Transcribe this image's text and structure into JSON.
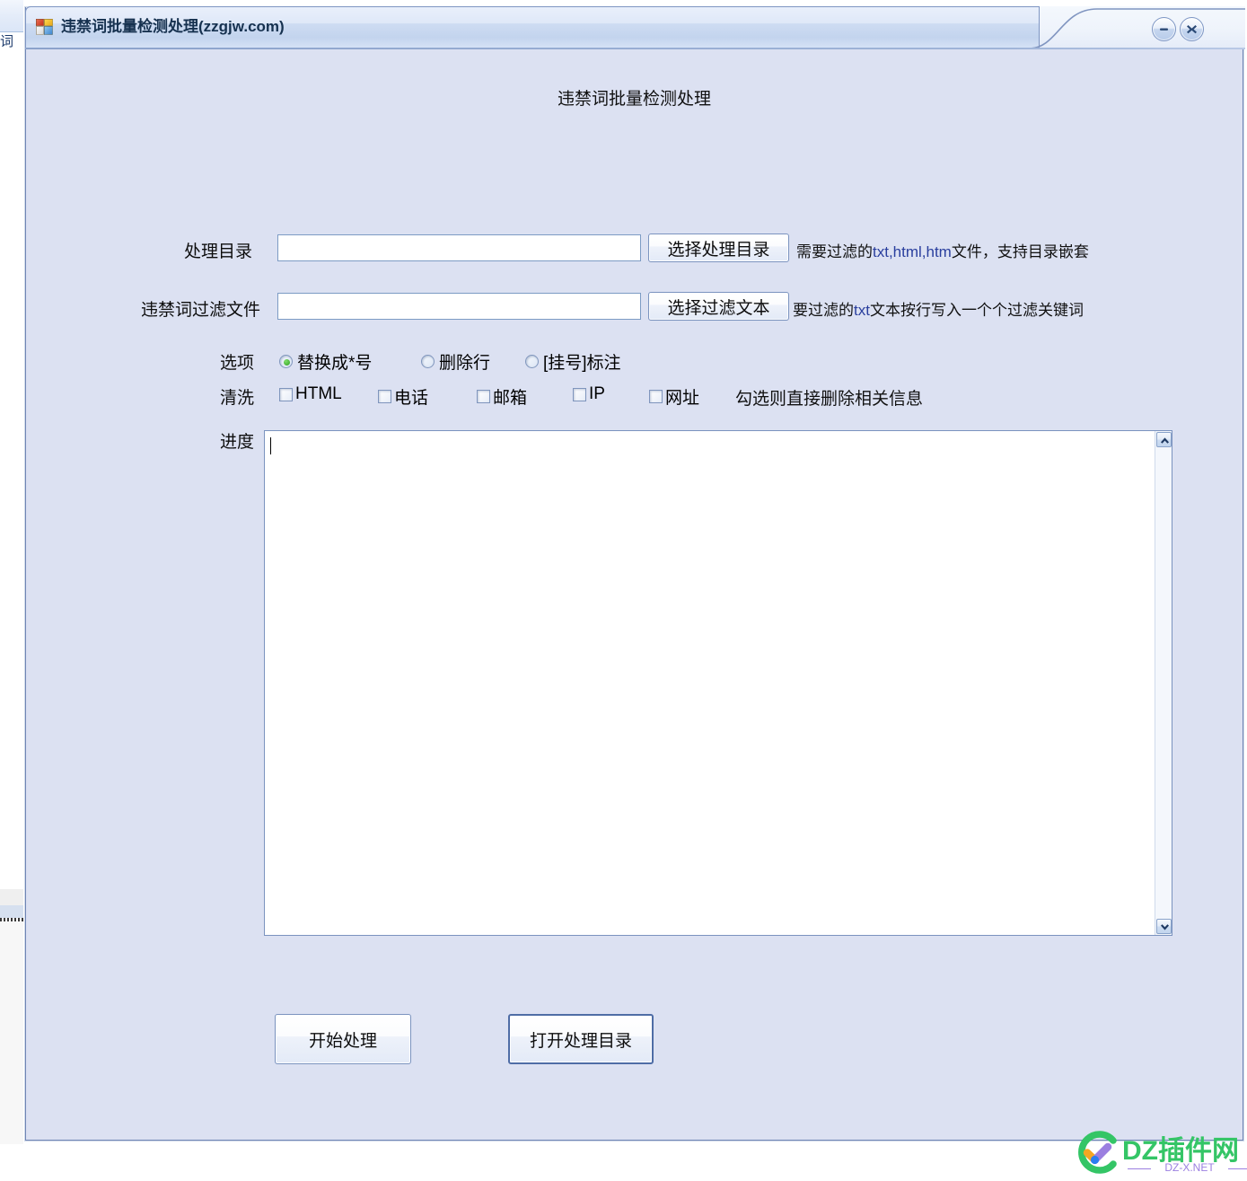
{
  "window": {
    "title": "违禁词批量检测处理(zzgjw.com)",
    "icon": "app-tiles-icon",
    "controls": {
      "minimize_label": "minimize-icon",
      "close_label": "close-icon"
    }
  },
  "heading": "违禁词批量检测处理",
  "form": {
    "dir_row": {
      "label": "处理目录",
      "value": "",
      "placeholder": "",
      "button": "选择处理目录",
      "hint_prefix": "需要过滤的",
      "hint_mono": "txt,html,htm",
      "hint_suffix": "文件，支持目录嵌套"
    },
    "filter_row": {
      "label": "违禁词过滤文件",
      "value": "",
      "placeholder": "",
      "button": "选择过滤文本",
      "hint_prefix": "要过滤的",
      "hint_mono": "txt",
      "hint_suffix": "文本按行写入一个个过滤关键词"
    },
    "options_row": {
      "label": "选项",
      "items": [
        {
          "label": "替换成*号",
          "selected": true
        },
        {
          "label": "删除行",
          "selected": false
        },
        {
          "label": "[挂号]标注",
          "selected": false
        }
      ]
    },
    "clean_row": {
      "label": "清洗",
      "items": [
        {
          "label": "HTML",
          "checked": false
        },
        {
          "label": "电话",
          "checked": false
        },
        {
          "label": "邮箱",
          "checked": false
        },
        {
          "label": "IP",
          "checked": false
        },
        {
          "label": "网址",
          "checked": false
        }
      ],
      "hint": "勾选则直接删除相关信息"
    },
    "progress_row": {
      "label": "进度",
      "value": ""
    }
  },
  "actions": {
    "start": "开始处理",
    "open_dir": "打开处理目录"
  },
  "watermark": {
    "brand": "DZ插件网",
    "domain": "DZ-X.NET",
    "brand_color": "#34c566",
    "domain_color": "#9b7fe0"
  },
  "colors": {
    "body_background": "#dce1f2",
    "window_border": "#6f85b5",
    "input_border": "#7c9bc4",
    "radio_selected": "#2f9e22"
  }
}
